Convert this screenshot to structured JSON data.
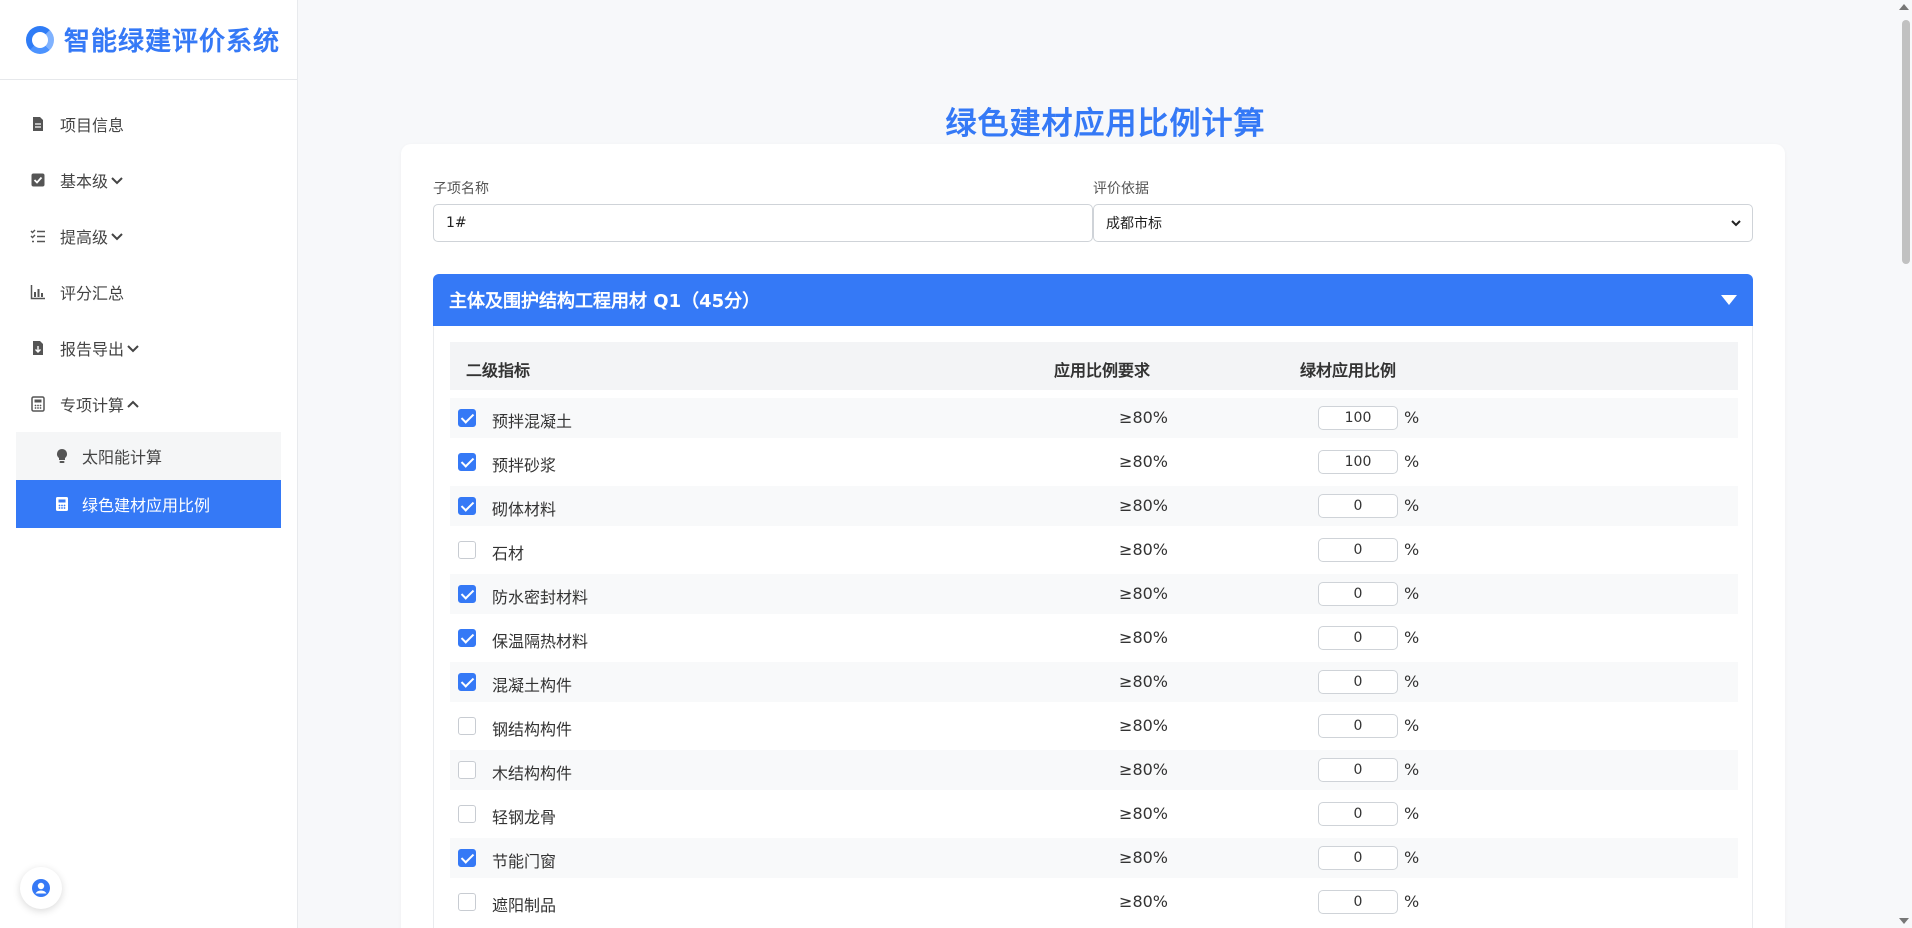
{
  "app": {
    "title": "智能绿建评价系统"
  },
  "sidebar": {
    "items": [
      {
        "label": "项目信息"
      },
      {
        "label": "基本级"
      },
      {
        "label": "提高级"
      },
      {
        "label": "评分汇总"
      },
      {
        "label": "报告导出"
      },
      {
        "label": "专项计算"
      }
    ],
    "sub_items": [
      {
        "label": "太阳能计算"
      },
      {
        "label": "绿色建材应用比例"
      }
    ]
  },
  "main": {
    "title": "绿色建材应用比例计算",
    "subitem_label": "子项名称",
    "subitem_value": "1#",
    "basis_label": "评价依据",
    "basis_value": "成都市标",
    "section_title": "主体及围护结构工程用材 Q1（45分）",
    "table_headers": {
      "col1": "二级指标",
      "col2": "应用比例要求",
      "col3": "绿材应用比例"
    },
    "percent_sign": "%",
    "rows": [
      {
        "name": "预拌混凝土",
        "requirement": "≥80%",
        "ratio": "100",
        "checked": true
      },
      {
        "name": "预拌砂浆",
        "requirement": "≥80%",
        "ratio": "100",
        "checked": true
      },
      {
        "name": "砌体材料",
        "requirement": "≥80%",
        "ratio": "0",
        "checked": true
      },
      {
        "name": "石材",
        "requirement": "≥80%",
        "ratio": "0",
        "checked": false
      },
      {
        "name": "防水密封材料",
        "requirement": "≥80%",
        "ratio": "0",
        "checked": true
      },
      {
        "name": "保温隔热材料",
        "requirement": "≥80%",
        "ratio": "0",
        "checked": true
      },
      {
        "name": "混凝土构件",
        "requirement": "≥80%",
        "ratio": "0",
        "checked": true
      },
      {
        "name": "钢结构构件",
        "requirement": "≥80%",
        "ratio": "0",
        "checked": false
      },
      {
        "name": "木结构构件",
        "requirement": "≥80%",
        "ratio": "0",
        "checked": false
      },
      {
        "name": "轻钢龙骨",
        "requirement": "≥80%",
        "ratio": "0",
        "checked": false
      },
      {
        "name": "节能门窗",
        "requirement": "≥80%",
        "ratio": "0",
        "checked": true
      },
      {
        "name": "遮阳制品",
        "requirement": "≥80%",
        "ratio": "0",
        "checked": false
      }
    ]
  },
  "colors": {
    "accent": "#3579f6",
    "sidebar_bg": "#ffffff",
    "page_bg": "#f7f8fa"
  }
}
